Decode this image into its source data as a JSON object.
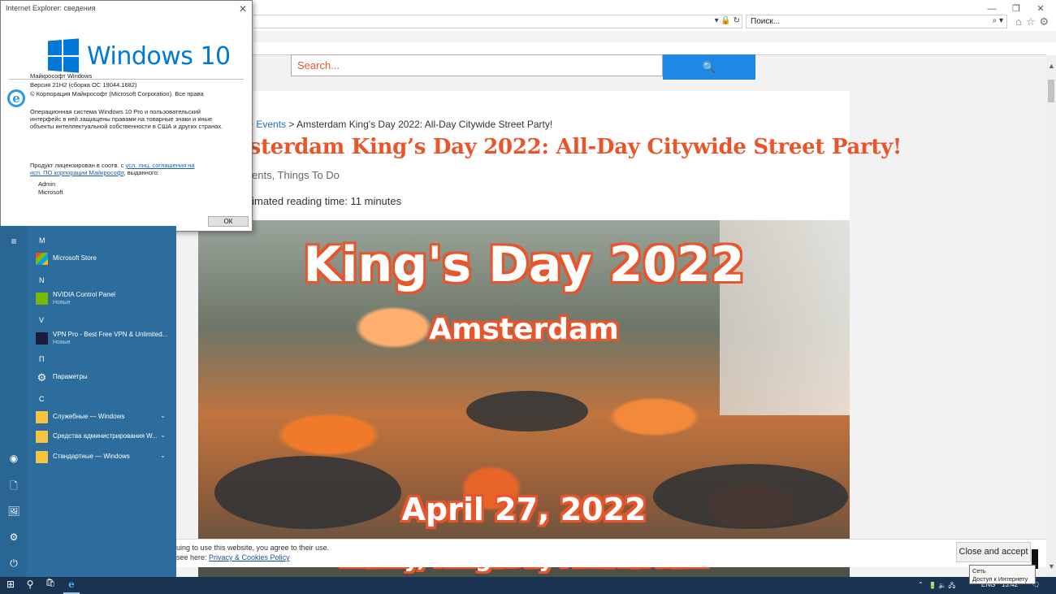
{
  "ie": {
    "search_placeholder": "Поиск...",
    "addr_buttons": "▾ 🔒 ↻",
    "search_icon": "⌕ ▾",
    "toolbar_icons": "⌂☆⚙",
    "win_min": "—",
    "win_restore": "❐",
    "win_close": "✕"
  },
  "page": {
    "site_search_placeholder": "Search...",
    "site_search_button": "🔍",
    "breadcrumb_sep1": ">",
    "breadcrumb_events": "Events",
    "breadcrumb_sep2": ">",
    "breadcrumb_current": "Amsterdam King's Day 2022: All-Day Citywide Street Party!",
    "title": "nsterdam King’s Day 2022: All-Day Citywide Street Party!",
    "categories": "ents, Things To Do",
    "reading_time": "stimated reading time: 11 minutes",
    "hero_line1": "King's Day 2022",
    "hero_line2": "Amsterdam",
    "hero_line3": "April 27, 2022",
    "hero_line4": "...ainy, KingsDay Amsterdam",
    "cookie_line1": "uing to use this website, you agree to their use.",
    "cookie_line2_prefix": "see here: ",
    "cookie_link": "Privacy & Cookies Policy",
    "cookie_button": "Close and accept",
    "scroll_up": "▲",
    "scroll_down": "▼"
  },
  "about_dialog": {
    "title": "Internet Explorer: сведения",
    "close": "✕",
    "windows_brand": "Windows 10",
    "ie_logo": "e",
    "line_product": "Майкрософт Windows",
    "line_version": "Версия 21H2 (сборка ОС 19044.1682)",
    "line_copyright": "© Корпорация Майкрософт (Microsoft Corporation). Все права",
    "para1_l1": "Операционная система Windows 10 Pro и пользовательский",
    "para1_l2": "интерфейс в ней защищены правами на товарные знаки и иные",
    "para1_l3": "объекты интеллектуальной собственности в США и других странах.",
    "license_prefix": "Продукт лицензирован в соотв. с ",
    "license_link1": "усл. лиц. соглашения на",
    "license_link2": "исп. ПО корпорации Майкрософт",
    "license_suffix": ", выданного:",
    "user1": "Admin",
    "user2": "Microsoft",
    "ok": "ОК"
  },
  "start_menu": {
    "rail": {
      "hamburger": "≡",
      "user": "◉",
      "documents": "🗋",
      "pictures": "🖼",
      "settings": "⚙",
      "power": "⏻"
    },
    "sections": [
      "M",
      "N",
      "V",
      "П",
      "С"
    ],
    "apps": [
      {
        "name": "Microsoft Store",
        "sub": ""
      },
      {
        "name": "NVIDIA Control Panel",
        "sub": "Новые"
      },
      {
        "name": "VPN Pro - Best Free VPN & Unlimited...",
        "sub": "Новые"
      },
      {
        "name": "Параметры",
        "sub": ""
      },
      {
        "name": "Служебные — Windows",
        "sub": "",
        "chevron": "⌄"
      },
      {
        "name": "Средства администрирования W...",
        "sub": "",
        "chevron": "⌄"
      },
      {
        "name": "Стандартные — Windows",
        "sub": "",
        "chevron": "⌄"
      }
    ],
    "colors": {
      "menu_bg": "#2c6d9e",
      "rail_bg": "#2a6694"
    }
  },
  "taskbar": {
    "start": "⊞",
    "search": "⚲",
    "store": "🛍",
    "ie": "e",
    "tray_chevron": "⌃",
    "tray_icons": "🔋 🔈 🖧",
    "lang": "ENG",
    "time": "13:42",
    "notifications": "🗨",
    "tooltip_l1": "Сеть",
    "tooltip_l2": "Доступ к Интернету"
  },
  "colors": {
    "accent_orange": "#e8552a",
    "search_blue": "#1e88e5",
    "windows_blue": "#0078d7",
    "taskbar": "#1a3350"
  }
}
